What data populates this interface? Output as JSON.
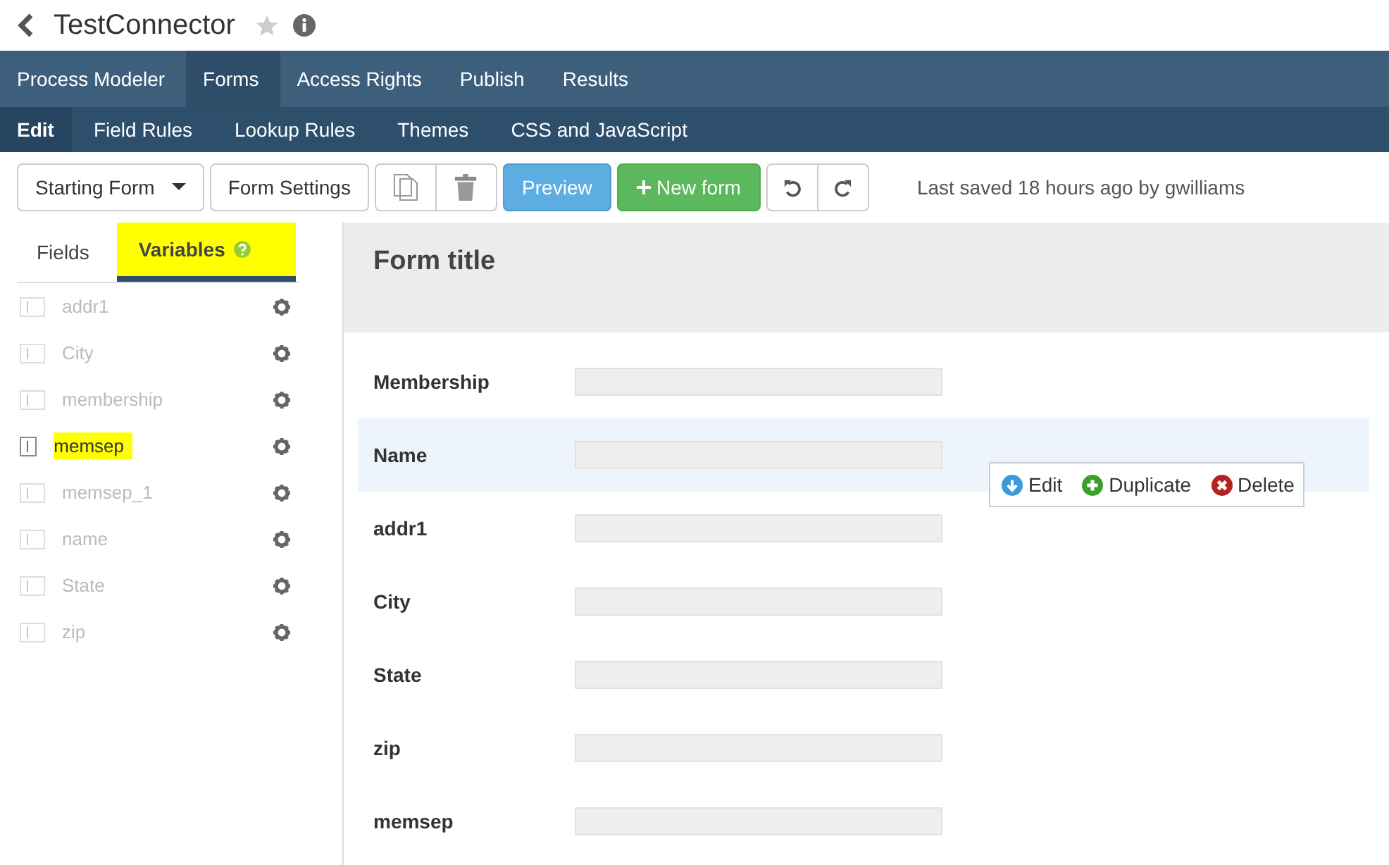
{
  "header": {
    "title": "TestConnector"
  },
  "main_tabs": [
    {
      "label": "Process Modeler",
      "selected": false
    },
    {
      "label": "Forms",
      "selected": true
    },
    {
      "label": "Access Rights",
      "selected": false
    },
    {
      "label": "Publish",
      "selected": false
    },
    {
      "label": "Results",
      "selected": false
    }
  ],
  "sub_tabs": [
    {
      "label": "Edit",
      "selected": true
    },
    {
      "label": "Field Rules",
      "selected": false
    },
    {
      "label": "Lookup Rules",
      "selected": false
    },
    {
      "label": "Themes",
      "selected": false
    },
    {
      "label": "CSS and JavaScript",
      "selected": false
    }
  ],
  "toolbar": {
    "starting_form": "Starting Form",
    "form_settings": "Form Settings",
    "preview": "Preview",
    "new_form": "New form",
    "status": "Last saved 18 hours ago by gwilliams"
  },
  "panel_tabs": [
    {
      "label": "Fields",
      "selected": false,
      "highlighted": false
    },
    {
      "label": "Variables",
      "selected": true,
      "highlighted": true
    }
  ],
  "variables": [
    {
      "name": "addr1",
      "selected": false,
      "highlighted": false
    },
    {
      "name": "City",
      "selected": false,
      "highlighted": false
    },
    {
      "name": "membership",
      "selected": false,
      "highlighted": false
    },
    {
      "name": "memsep",
      "selected": true,
      "highlighted": true
    },
    {
      "name": "memsep_1",
      "selected": false,
      "highlighted": false
    },
    {
      "name": "name",
      "selected": false,
      "highlighted": false
    },
    {
      "name": "State",
      "selected": false,
      "highlighted": false
    },
    {
      "name": "zip",
      "selected": false,
      "highlighted": false
    }
  ],
  "form": {
    "title": "Form title",
    "fields": [
      {
        "label": "Membership",
        "selected": false
      },
      {
        "label": "Name",
        "selected": true
      },
      {
        "label": "addr1",
        "selected": false
      },
      {
        "label": "City",
        "selected": false
      },
      {
        "label": "State",
        "selected": false
      },
      {
        "label": "zip",
        "selected": false
      },
      {
        "label": "memsep",
        "selected": false
      }
    ],
    "actions": [
      {
        "label": "Edit",
        "kind": "edit"
      },
      {
        "label": "Duplicate",
        "kind": "duplicate"
      },
      {
        "label": "Delete",
        "kind": "delete"
      }
    ]
  }
}
